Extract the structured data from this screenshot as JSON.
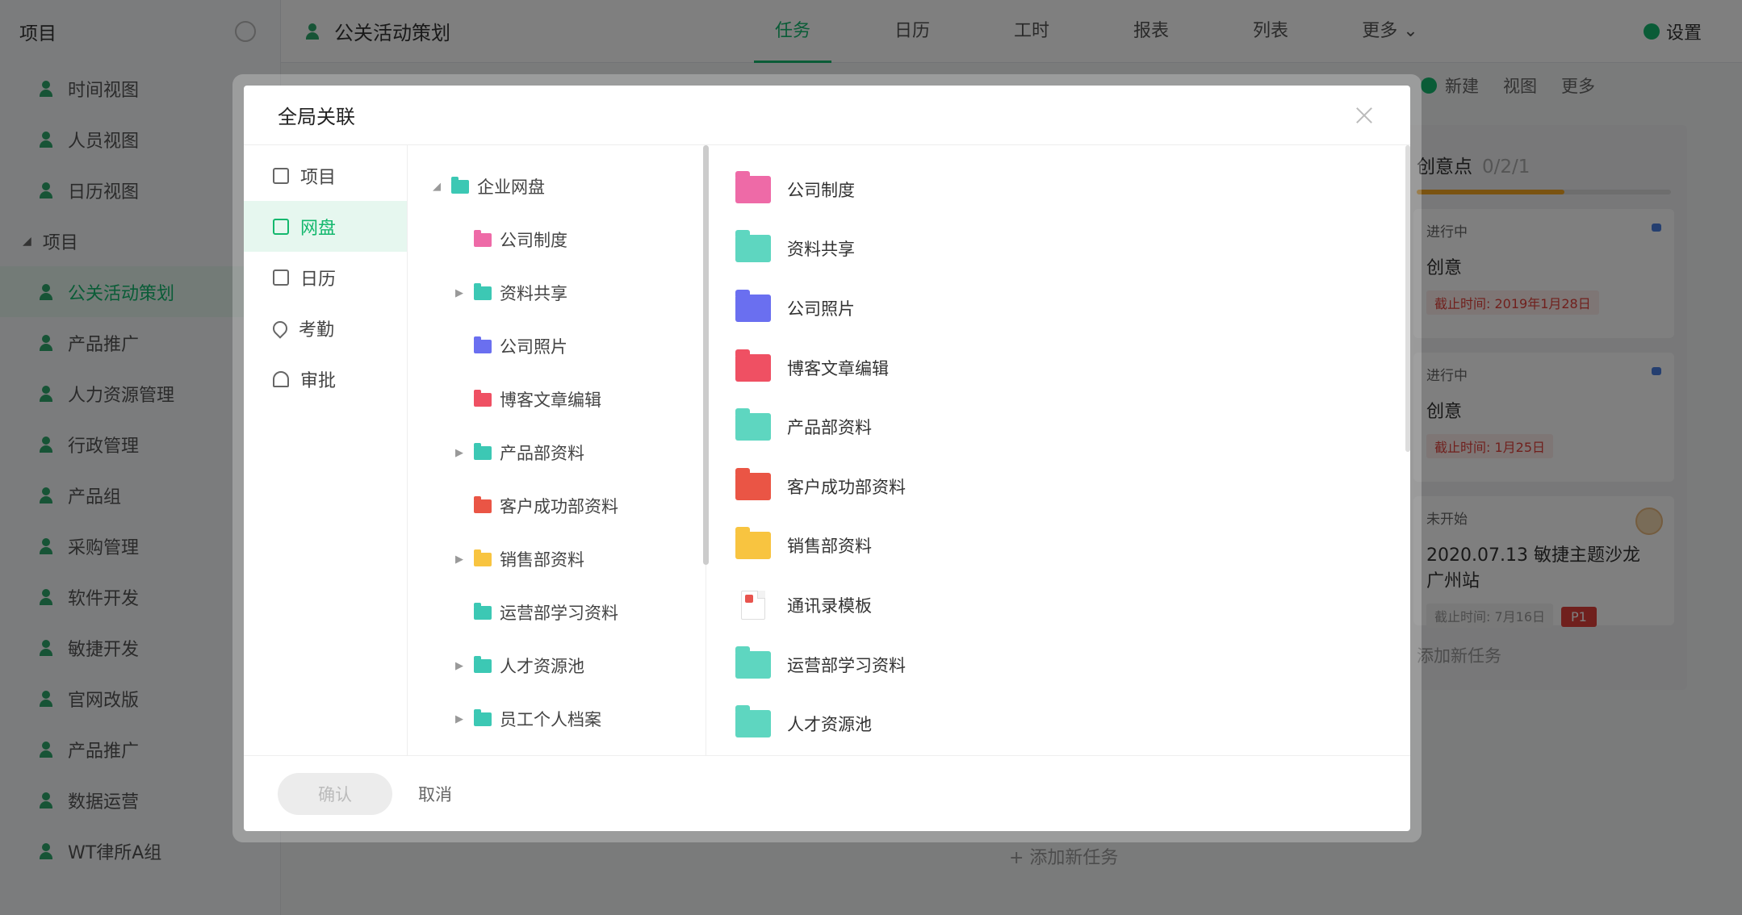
{
  "sidebar": {
    "header": "项目",
    "views": [
      "时间视图",
      "人员视图",
      "日历视图"
    ],
    "group_label": "项目",
    "projects": [
      "公关活动策划",
      "产品推广",
      "人力资源管理",
      "行政管理",
      "产品组",
      "采购管理",
      "软件开发",
      "敏捷开发",
      "官网改版",
      "产品推广",
      "数据运营",
      "WT律所A组"
    ]
  },
  "topbar": {
    "project_title": "公关活动策划",
    "tabs": [
      "任务",
      "日历",
      "工时",
      "报表",
      "列表",
      "更多 ⌄"
    ],
    "settings": "设置"
  },
  "toolbar": {
    "new": "新建",
    "view": "视图",
    "more": "更多"
  },
  "column": {
    "title": "创意点",
    "count": "0/2/1",
    "cards": [
      {
        "status": "进行中",
        "title": "创意",
        "deadline": "截止时间: 2019年1月28日"
      },
      {
        "status": "进行中",
        "title": "创意",
        "deadline": "截止时间: 1月25日"
      },
      {
        "status": "未开始",
        "title": "2020.07.13 敏捷主题沙龙 广州站",
        "deadline": "截止时间: 7月16日",
        "priority": "P1"
      }
    ],
    "add_task": "添加新任务"
  },
  "bottom_add_task": "+ 添加新任务",
  "modal": {
    "title": "全局关联",
    "categories": [
      "项目",
      "网盘",
      "日历",
      "考勤",
      "审批"
    ],
    "tree": [
      {
        "label": "企业网盘",
        "color": "#3cc8b4",
        "arrow": "◢",
        "level": 0
      },
      {
        "label": "公司制度",
        "color": "#ee6aa7",
        "arrow": "",
        "level": 1
      },
      {
        "label": "资料共享",
        "color": "#3cc8b4",
        "arrow": "▶",
        "level": 1
      },
      {
        "label": "公司照片",
        "color": "#6a6ff0",
        "arrow": "",
        "level": 1
      },
      {
        "label": "博客文章编辑",
        "color": "#ef5063",
        "arrow": "",
        "level": 1
      },
      {
        "label": "产品部资料",
        "color": "#3cc8b4",
        "arrow": "▶",
        "level": 1
      },
      {
        "label": "客户成功部资料",
        "color": "#ea5545",
        "arrow": "",
        "level": 1
      },
      {
        "label": "销售部资料",
        "color": "#f8c440",
        "arrow": "▶",
        "level": 1
      },
      {
        "label": "运营部学习资料",
        "color": "#3cc8b4",
        "arrow": "",
        "level": 1
      },
      {
        "label": "人才资源池",
        "color": "#3cc8b4",
        "arrow": "▶",
        "level": 1
      },
      {
        "label": "员工个人档案",
        "color": "#3cc8b4",
        "arrow": "▶",
        "level": 1
      }
    ],
    "files": [
      {
        "label": "公司制度",
        "type": "folder",
        "color": "#ee6aa7"
      },
      {
        "label": "资料共享",
        "type": "folder",
        "color": "#5ed6c0"
      },
      {
        "label": "公司照片",
        "type": "folder",
        "color": "#6a6ff0"
      },
      {
        "label": "博客文章编辑",
        "type": "folder",
        "color": "#ef5063"
      },
      {
        "label": "产品部资料",
        "type": "folder",
        "color": "#5ed6c0"
      },
      {
        "label": "客户成功部资料",
        "type": "folder",
        "color": "#ea5545"
      },
      {
        "label": "销售部资料",
        "type": "folder",
        "color": "#f8c440"
      },
      {
        "label": "通讯录模板",
        "type": "doc",
        "color": "#e8544e"
      },
      {
        "label": "运营部学习资料",
        "type": "folder",
        "color": "#5ed6c0"
      },
      {
        "label": "人才资源池",
        "type": "folder",
        "color": "#5ed6c0"
      }
    ],
    "confirm": "确认",
    "cancel": "取消"
  },
  "colors": {
    "accent": "#14b86e",
    "danger": "#e0403a"
  }
}
